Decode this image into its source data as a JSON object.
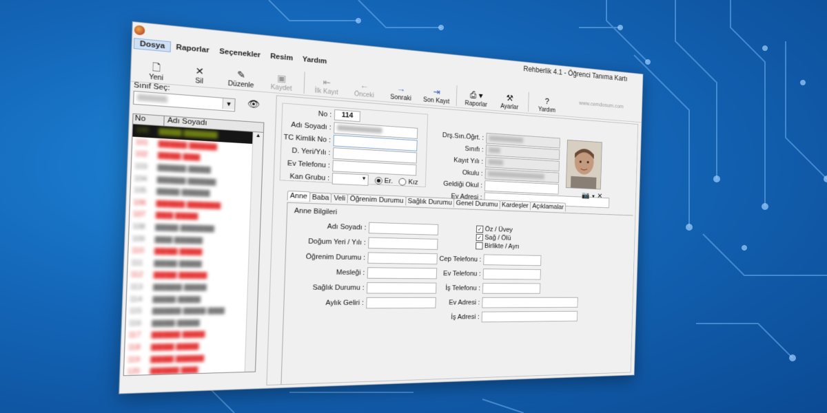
{
  "window": {
    "title": "Rehberlik 4.1 - Öğrenci Tanıma Kartı"
  },
  "menu": {
    "items": [
      "Dosya",
      "Raporlar",
      "Seçenekler",
      "Resim",
      "Yardım"
    ]
  },
  "toolbar": {
    "new": "Yeni",
    "delete": "Sil",
    "edit": "Düzenle",
    "save": "Kaydet",
    "first": "İlk Kayıt",
    "prev": "Önceki",
    "next": "Sonraki",
    "last": "Son Kayıt",
    "reports": "Raporlar",
    "settings": "Ayarlar",
    "help": "Yardım",
    "website": "www.cemdosum.com"
  },
  "left_panel": {
    "class_label": "Sınıf Seç:",
    "grid_headers": {
      "no": "No",
      "name": "Adı Soyadı"
    }
  },
  "form": {
    "no_label": "No :",
    "no_value": "114",
    "name_label": "Adı Soyadı :",
    "tc_label": "TC Kimlik No :",
    "birth_label": "D. Yeri/Yılı :",
    "home_phone_label": "Ev Telefonu :",
    "blood_label": "Kan Grubu :",
    "gender_male": "Er.",
    "gender_female": "Kız",
    "advisor_label": "Drş.Sın.Öğrt. :",
    "class_label": "Sınıfı :",
    "reg_year_label": "Kayıt Yılı :",
    "school_label": "Okulu :",
    "prev_school_label": "Geldiği Okul :",
    "address_label": "Ev Adresi :"
  },
  "tabs": [
    "Anne",
    "Baba",
    "Veli",
    "Öğrenim Durumu",
    "Sağlık Durumu",
    "Genel Durumu",
    "Kardeşler",
    "Açıklamalar"
  ],
  "mother": {
    "section_title": "Anne Bilgileri",
    "name_label": "Adı Soyadı :",
    "birth_label": "Doğum Yeri / Yılı :",
    "education_label": "Öğrenim Durumu :",
    "job_label": "Mesleği :",
    "health_label": "Sağlık Durumu :",
    "income_label": "Aylık Geliri :",
    "cb_step": "Öz / Üvey",
    "cb_alive": "Sağ / Ölü",
    "cb_together": "Birlikte / Ayrı",
    "cell_label": "Cep Telefonu :",
    "home_phone_label": "Ev Telefonu :",
    "work_phone_label": "İş Telefonu :",
    "home_address_label": "Ev Adresi :",
    "work_address_label": "İş Adresi :"
  }
}
